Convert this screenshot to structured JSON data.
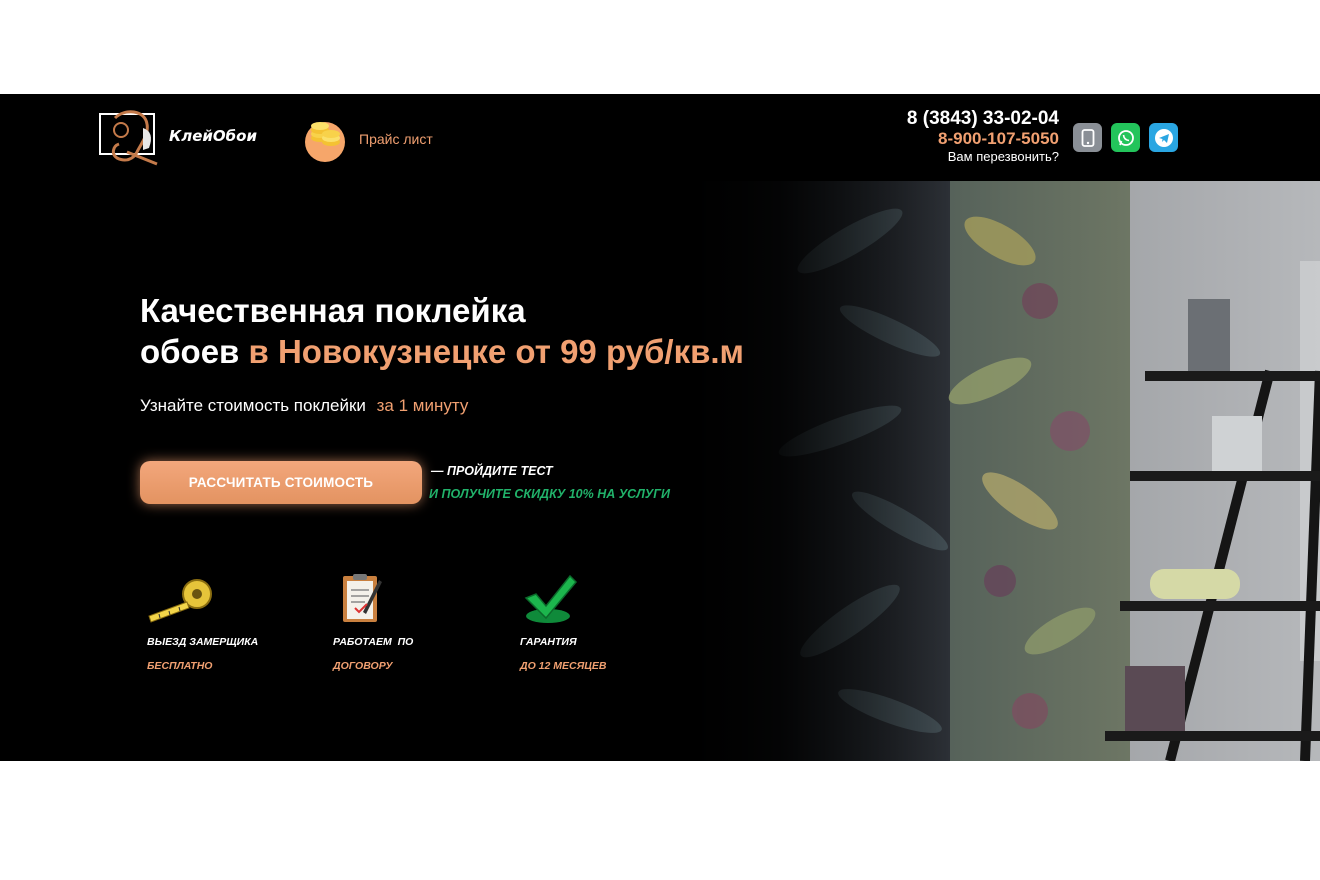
{
  "brand": {
    "logo_text": "КлейОбои"
  },
  "header": {
    "price_list_label": "Прайс лист",
    "phone_primary": "8 (3843) 33-02-04",
    "phone_secondary": "8-900-107-5050",
    "callback_label": "Вам перезвонить?",
    "messengers": [
      "phone-icon",
      "whatsapp-icon",
      "telegram-icon"
    ]
  },
  "hero": {
    "headline_line1": "Качественная поклейка",
    "headline_line2_plain": "обоев",
    "headline_line2_accent": "в Новокузнецке от 99 руб/кв.м",
    "subline_plain": "Узнайте стоимость поклейки",
    "subline_accent": "за 1 минуту",
    "cta_label": "РАССЧИТАТЬ СТОИМОСТЬ",
    "cta_note_1": "— ПРОЙДИТЕ ТЕСТ",
    "cta_note_2": "И ПОЛУЧИТЕ СКИДКУ 10% НА УСЛУГИ"
  },
  "features": [
    {
      "icon": "tape-measure-icon",
      "title": "ВЫЕЗД ЗАМЕРЩИКА",
      "subtitle": "БЕСПЛАТНО"
    },
    {
      "icon": "clipboard-icon",
      "title": "РАБОТАЕМ  ПО",
      "subtitle": "ДОГОВОРУ"
    },
    {
      "icon": "checkmark-icon",
      "title": "ГАРАНТИЯ",
      "subtitle": "ДО 12 МЕСЯЦЕВ"
    }
  ],
  "colors": {
    "accent": "#f1a071",
    "green": "#21b26a",
    "background": "#000000"
  }
}
